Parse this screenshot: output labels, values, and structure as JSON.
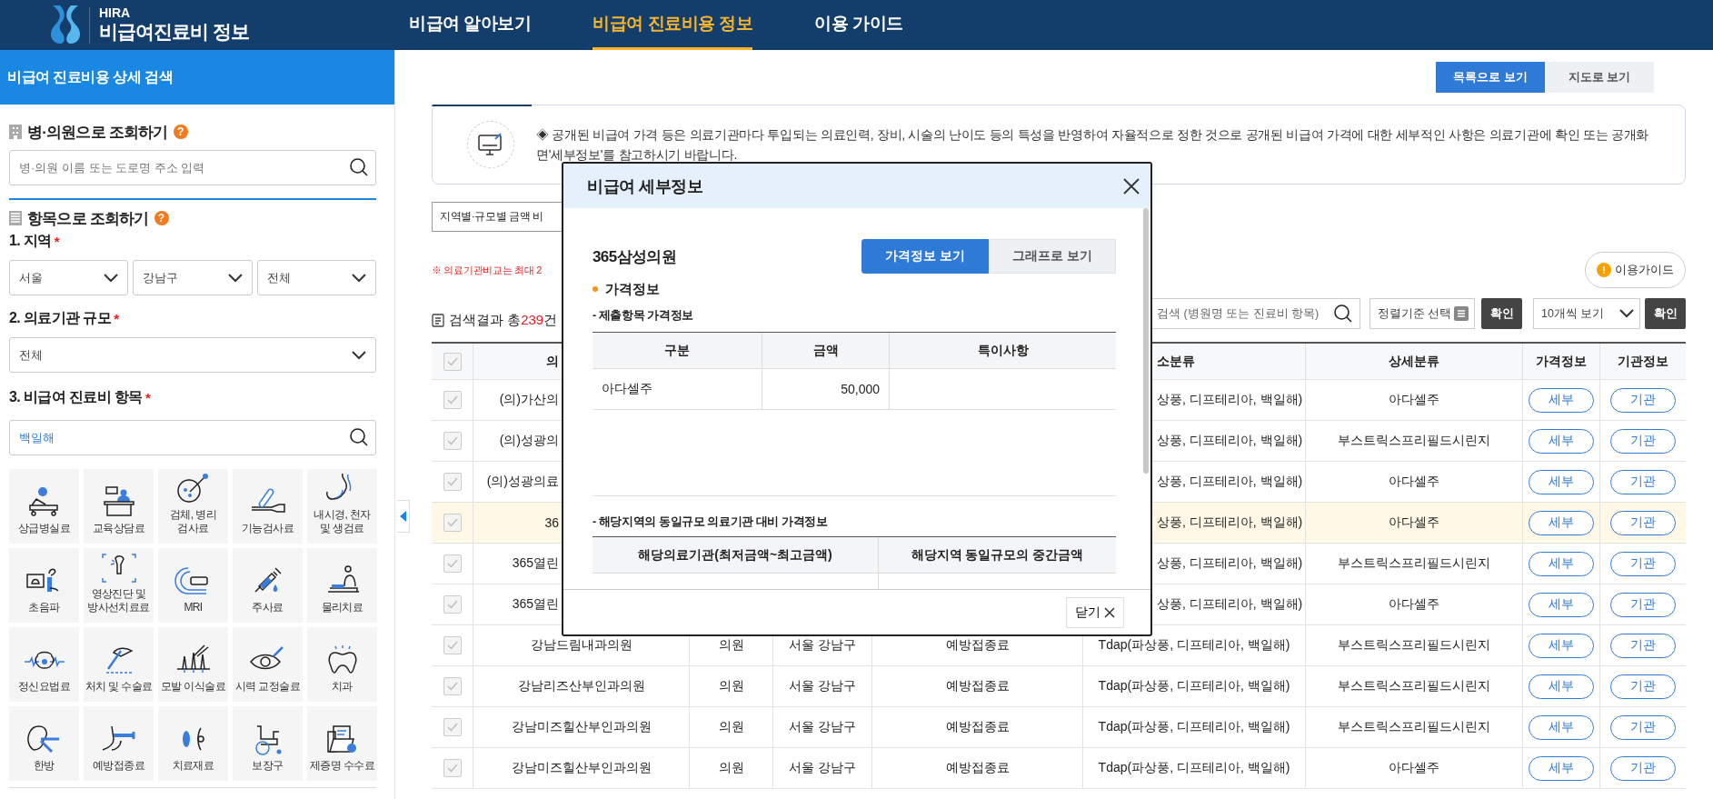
{
  "header": {
    "logo_small": "HIRA",
    "logo_title": "비급여진료비 정보",
    "nav": [
      {
        "label": "비급여 알아보기",
        "selected": false
      },
      {
        "label": "비급여 진료비용 정보",
        "selected": true
      },
      {
        "label": "이용 가이드",
        "selected": false
      }
    ]
  },
  "sidebar": {
    "title": "비급여 진료비용 상세 검색",
    "hospital_search": {
      "heading": "병·의원으로 조회하기",
      "help": "?",
      "placeholder": "병·의원 이름 또는 도로명 주소 입력"
    },
    "item_search": {
      "heading": "항목으로 조회하기",
      "help": "?"
    },
    "region": {
      "label": "1. 지역",
      "required": "*",
      "selects": [
        "서울",
        "강남구",
        "전체"
      ]
    },
    "scale": {
      "label": "2. 의료기관 규모",
      "required": "*",
      "select": "전체"
    },
    "item": {
      "label": "3. 비급여 진료비 항목",
      "required": "*",
      "value": "백일해"
    },
    "categories": [
      {
        "label": "상급병실료"
      },
      {
        "label": "교육상담료"
      },
      {
        "label": "검체, 병리\n검사료"
      },
      {
        "label": "기능검사료"
      },
      {
        "label": "내시경, 천자\n및 생검료"
      },
      {
        "label": "초음파"
      },
      {
        "label": "영상진단 및\n방사선치료료"
      },
      {
        "label": "MRI"
      },
      {
        "label": "주사료"
      },
      {
        "label": "물리치료"
      },
      {
        "label": "정신요법료"
      },
      {
        "label": "처치 및 수술료"
      },
      {
        "label": "모발 이식술료"
      },
      {
        "label": "시력 교정술료"
      },
      {
        "label": "치과"
      },
      {
        "label": "한방"
      },
      {
        "label": "예방접종료"
      },
      {
        "label": "치료재료"
      },
      {
        "label": "보장구"
      },
      {
        "label": "제증명 수수료"
      }
    ]
  },
  "main": {
    "view_toggle": [
      {
        "label": "목록으로 보기",
        "selected": true
      },
      {
        "label": "지도로 보기",
        "selected": false
      }
    ],
    "notice": "◈ 공개된 비급여 가격 등은 의료기관마다 투입되는 의료인력, 장비, 시술의 난이도 등의 특성을 반영하여 자율적으로 정한 것으로 공개된 비급여 가격에 대한 세부적인 사항은 의료기관에 확인 또는 공개화면'세부정보'를 참고하시기 바랍니다.",
    "compare_select": "지역별·규모별 금액 비",
    "compare_note": "※ 의료기관비교는 최대 2",
    "guide_button": {
      "icon": "!",
      "label": "이용가이드"
    },
    "result_count": {
      "prefix": "검색결과 총",
      "count": "239",
      "suffix": "건"
    },
    "search_placeholder": "검색 (병원명 또는 진료비 항목)",
    "sort_select": "정렬기준 선택",
    "sort_confirm": "확인",
    "page_size": "10개씩 보기",
    "page_confirm": "확인",
    "table": {
      "header_checked": false,
      "columns": [
        "의",
        null,
        null,
        null,
        "소분류",
        "상세분류",
        "가격정보",
        "기관정보"
      ],
      "rows": [
        {
          "selected": false,
          "checked": false,
          "cells": [
            "(의)가산의",
            null,
            null,
            null,
            "상풍, 디프테리아, 백일해)",
            "아다셀주"
          ],
          "price_button": "세부",
          "org_button": "기관"
        },
        {
          "selected": false,
          "checked": false,
          "cells": [
            "(의)성광의",
            null,
            null,
            null,
            "상풍, 디프테리아, 백일해)",
            "부스트릭스프리필드시린지"
          ],
          "price_button": "세부",
          "org_button": "기관"
        },
        {
          "selected": false,
          "checked": false,
          "cells": [
            "(의)성광의료",
            null,
            null,
            null,
            "상풍, 디프테리아, 백일해)",
            "아다셀주"
          ],
          "price_button": "세부",
          "org_button": "기관"
        },
        {
          "selected": true,
          "checked": false,
          "cells": [
            "36",
            null,
            null,
            null,
            "상풍, 디프테리아, 백일해)",
            "아다셀주"
          ],
          "price_button": "세부",
          "org_button": "기관"
        },
        {
          "selected": false,
          "checked": false,
          "cells": [
            "365열린",
            null,
            null,
            null,
            "상풍, 디프테리아, 백일해)",
            "부스트릭스프리필드시린지"
          ],
          "price_button": "세부",
          "org_button": "기관"
        },
        {
          "selected": false,
          "checked": false,
          "cells": [
            "365열린",
            null,
            null,
            null,
            "상풍, 디프테리아, 백일해)",
            "아다셀주"
          ],
          "price_button": "세부",
          "org_button": "기관"
        },
        {
          "selected": false,
          "checked": false,
          "cells": [
            "강남드림내과의원",
            "의원",
            "서울 강남구",
            "예방접종료",
            "Tdap(파상풍, 디프테리아, 백일해)",
            "부스트릭스프리필드시린지"
          ],
          "price_button": "세부",
          "org_button": "기관"
        },
        {
          "selected": false,
          "checked": false,
          "cells": [
            "강남리즈산부인과의원",
            "의원",
            "서울 강남구",
            "예방접종료",
            "Tdap(파상풍, 디프테리아, 백일해)",
            "부스트릭스프리필드시린지"
          ],
          "price_button": "세부",
          "org_button": "기관"
        },
        {
          "selected": false,
          "checked": false,
          "cells": [
            "강남미즈힐산부인과의원",
            "의원",
            "서울 강남구",
            "예방접종료",
            "Tdap(파상풍, 디프테리아, 백일해)",
            "부스트릭스프리필드시린지"
          ],
          "price_button": "세부",
          "org_button": "기관"
        },
        {
          "selected": false,
          "checked": false,
          "cells": [
            "강남미즈힐산부인과의원",
            "의원",
            "서울 강남구",
            "예방접종료",
            "Tdap(파상풍, 디프테리아, 백일해)",
            "아다셀주"
          ],
          "price_button": "세부",
          "org_button": "기관"
        }
      ]
    }
  },
  "modal": {
    "title": "비급여 세부정보",
    "hospital": "365삼성의원",
    "tabs": [
      {
        "label": "가격정보 보기",
        "selected": true
      },
      {
        "label": "그래프로 보기",
        "selected": false
      }
    ],
    "section": "가격정보",
    "submitted_title": "- 제출항목 가격정보",
    "price_table": {
      "columns": [
        "구분",
        "금액",
        "특이사항"
      ],
      "rows": [
        {
          "item": "아다셀주",
          "amount": "50,000"
        }
      ]
    },
    "compare_title": "- 해당지역의 동일규모 의료기관 대비 가격정보",
    "compare_table": {
      "columns": [
        "해당의료기관(최저금액~최고금액)",
        "해당지역 동일규모의 중간금액"
      ]
    },
    "close_button": "닫기"
  }
}
